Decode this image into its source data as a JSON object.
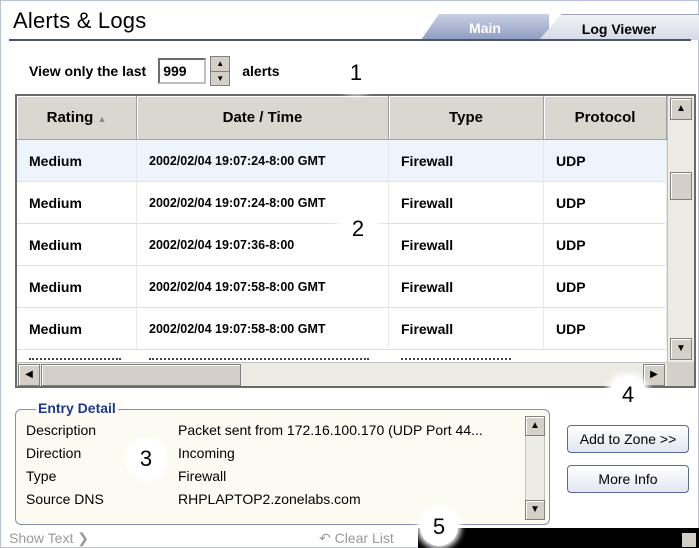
{
  "header": {
    "title": "Alerts & Logs"
  },
  "tabs": [
    {
      "label": "Main",
      "active": false
    },
    {
      "label": "Log Viewer",
      "active": true
    }
  ],
  "filter": {
    "prefix": "View only the last",
    "value": "999",
    "suffix": "alerts"
  },
  "callouts": [
    "1",
    "2",
    "3",
    "4",
    "5"
  ],
  "table": {
    "columns": [
      "Rating",
      "Date / Time",
      "Type",
      "Protocol"
    ],
    "sort_indicator": "▲",
    "rows": [
      {
        "rating": "Medium",
        "datetime": "2002/02/04 19:07:24-8:00 GMT",
        "type": "Firewall",
        "protocol": "UDP",
        "selected": true
      },
      {
        "rating": "Medium",
        "datetime": "2002/02/04 19:07:24-8:00 GMT",
        "type": "Firewall",
        "protocol": "UDP"
      },
      {
        "rating": "Medium",
        "datetime": "2002/02/04 19:07:36-8:00",
        "type": "Firewall",
        "protocol": "UDP"
      },
      {
        "rating": "Medium",
        "datetime": "2002/02/04 19:07:58-8:00 GMT",
        "type": "Firewall",
        "protocol": "UDP"
      },
      {
        "rating": "Medium",
        "datetime": "2002/02/04 19:07:58-8:00 GMT",
        "type": "Firewall",
        "protocol": "UDP"
      }
    ]
  },
  "detail": {
    "legend": "Entry Detail",
    "fields": [
      {
        "label": "Description",
        "value": "Packet sent from 172.16.100.170 (UDP Port 44..."
      },
      {
        "label": "Direction",
        "value": "Incoming"
      },
      {
        "label": "Type",
        "value": "Firewall"
      },
      {
        "label": "Source DNS",
        "value": "RHPLAPTOP2.zonelabs.com"
      }
    ]
  },
  "buttons": {
    "add_to_zone": "Add to Zone >>",
    "more_info": "More Info"
  },
  "footer": {
    "show_text": "Show Text ❯",
    "clear_list": "↶ Clear List"
  },
  "colors": {
    "header_rule": "#4a5670",
    "selected_row": "#eef4fb",
    "legend_text": "#1d3a8a",
    "disabled_text": "#9a9a9a"
  }
}
